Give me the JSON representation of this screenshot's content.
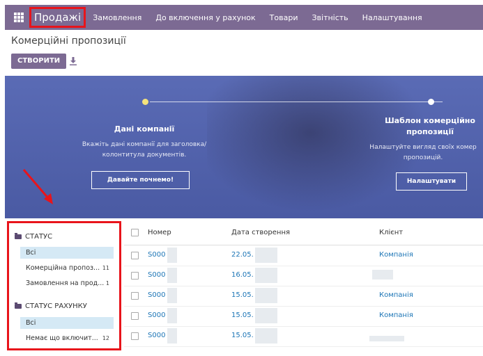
{
  "navbar": {
    "brand": "Продажі",
    "items": [
      "Замовлення",
      "До включення у рахунок",
      "Товари",
      "Звітність",
      "Налаштування"
    ]
  },
  "page": {
    "title": "Комерційні пропозиції",
    "create_label": "СТВОРИТИ"
  },
  "banner": {
    "step1": {
      "title": "Дані компанії",
      "desc_line1": "Вкажіть дані компанії для заголовка/",
      "desc_line2": "колонтитула документів.",
      "button": "Давайте почнемо!"
    },
    "step2": {
      "title_line1": "Шаблон комерційно",
      "title_line2": "пропозиції",
      "desc_line1": "Налаштуйте вигляд своїх комер",
      "desc_line2": "пропозицій.",
      "button": "Налаштувати"
    }
  },
  "sidebar": {
    "status_header": "СТАТУС",
    "status_items": [
      {
        "label": "Всі",
        "count": ""
      },
      {
        "label": "Комерційна пропоз...",
        "count": "11"
      },
      {
        "label": "Замовлення на прод...",
        "count": "1"
      }
    ],
    "invoice_header": "СТАТУС РАХУНКУ",
    "invoice_items": [
      {
        "label": "Всі",
        "count": ""
      },
      {
        "label": "Немає що включит...",
        "count": "12"
      }
    ]
  },
  "table": {
    "headers": {
      "number": "Номер",
      "date": "Дата створення",
      "client": "Клієнт"
    },
    "rows": [
      {
        "number": "S000",
        "date": "22.05.",
        "client": "Компанія"
      },
      {
        "number": "S000",
        "date": "16.05.",
        "client": ""
      },
      {
        "number": "S000",
        "date": "15.05.",
        "client": "Компанія"
      },
      {
        "number": "S000",
        "date": "15.05.",
        "client": "Компанія"
      },
      {
        "number": "S000",
        "date": "15.05.",
        "client": ""
      }
    ]
  },
  "colors": {
    "navbar": "#7c6a93",
    "highlight": "#e8141b",
    "link": "#1c75b6",
    "banner": "#5a6bb5"
  }
}
